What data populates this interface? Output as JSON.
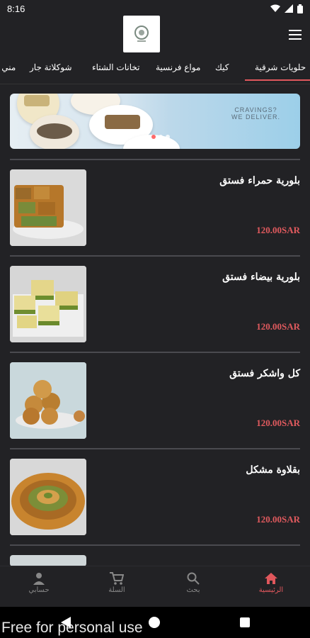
{
  "status_bar": {
    "time": "8:16"
  },
  "header": {
    "logo_alt": "store logo"
  },
  "tabs": [
    {
      "label": "حلويات شرقية",
      "active": true
    },
    {
      "label": "كيك",
      "active": false
    },
    {
      "label": "مواع فرنسية",
      "active": false
    },
    {
      "label": "تخانات الشتاء",
      "active": false
    },
    {
      "label": "شوكلاتة جار",
      "active": false
    },
    {
      "label": "مني ?",
      "active": false
    }
  ],
  "banner": {
    "line1": "CRAVINGS?",
    "line2": "WE DELIVER."
  },
  "products": [
    {
      "name": "بلورية حمراء فستق",
      "price": "120.00SAR"
    },
    {
      "name": "بلورية بيضاء فستق",
      "price": "120.00SAR"
    },
    {
      "name": "كل واشكر فستق",
      "price": "120.00SAR"
    },
    {
      "name": "بقلاوة مشكل",
      "price": "120.00SAR"
    }
  ],
  "bottom_nav": [
    {
      "label": "حسابي",
      "icon": "person-icon",
      "active": false
    },
    {
      "label": "السلة",
      "icon": "cart-icon",
      "active": false
    },
    {
      "label": "بحث",
      "icon": "search-icon",
      "active": false
    },
    {
      "label": "الرئيسية",
      "icon": "home-icon",
      "active": true
    }
  ],
  "watermark": "Free for personal use",
  "colors": {
    "accent": "#e0575c",
    "background": "#222225"
  }
}
